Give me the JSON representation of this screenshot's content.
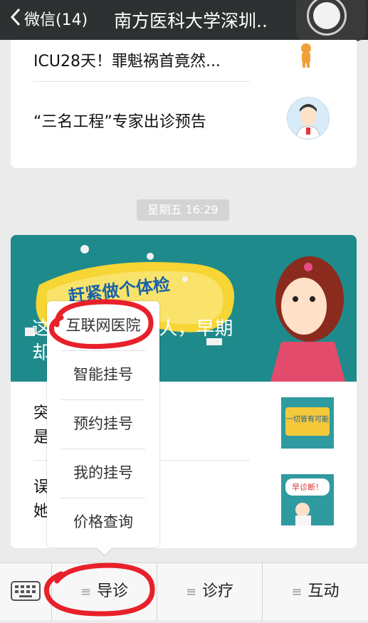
{
  "nav": {
    "back_label": "微信(14)",
    "title": "南方医科大学深圳.."
  },
  "feed": {
    "top_articles": [
      {
        "title": "ICU28天！罪魁祸首竟然..."
      },
      {
        "title": "“三名工程”专家出诊预告"
      }
    ],
    "timestamp": "星期五 16:29",
    "banner": {
      "headline": "赶紧做个体检",
      "line1": "这   ...     搞死32万人，早期",
      "line2": "却   ...     的！"
    },
    "articles": [
      {
        "line1": "突   ...   似中风，竟",
        "line2": "是   ...   久发病猛！",
        "thumb_text": "一切皆有可能"
      },
      {
        "line1": "误   ...   耳聋，如今",
        "line2": "她   ...   吵闹声",
        "thumb_text": "早诊断！"
      }
    ]
  },
  "popup_menu": {
    "items": [
      "互联网医院",
      "智能挂号",
      "预约挂号",
      "我的挂号",
      "价格查询"
    ]
  },
  "bottom_menu": {
    "items": [
      "导诊",
      "诊疗",
      "互动"
    ]
  },
  "colors": {
    "navbar": "#2e3132",
    "banner": "#1f8a8c",
    "annotation": "#e8202a"
  }
}
